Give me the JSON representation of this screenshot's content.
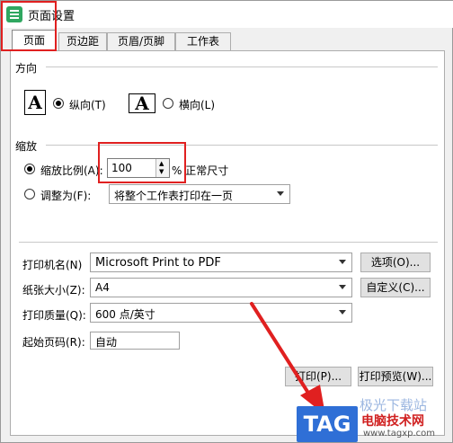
{
  "window": {
    "title": "页面设置"
  },
  "tabs": [
    {
      "label": "页面"
    },
    {
      "label": "页边距"
    },
    {
      "label": "页眉/页脚"
    },
    {
      "label": "工作表"
    }
  ],
  "orientation": {
    "section": "方向",
    "icon_glyph": "A",
    "portrait_label": "纵向(T)",
    "landscape_label": "横向(L)",
    "selected": "portrait"
  },
  "scaling": {
    "section": "缩放",
    "scale_label": "缩放比例(A):",
    "scale_value": "100",
    "scale_suffix": "% 正常尺寸",
    "fit_label": "调整为(F):",
    "fit_option": "将整个工作表打印在一页",
    "selected": "scale"
  },
  "printer": {
    "name_label": "打印机名(N)",
    "name_value": "Microsoft Print to PDF",
    "options_button": "选项(O)...",
    "paper_label": "纸张大小(Z):",
    "paper_value": "A4",
    "custom_button": "自定义(C)...",
    "quality_label": "打印质量(Q):",
    "quality_value": "600 点/英寸",
    "start_page_label": "起始页码(R):",
    "start_page_value": "自动"
  },
  "actions": {
    "print_button": "打印(P)...",
    "preview_button": "打印预览(W)..."
  },
  "watermark": {
    "tag": "TAG",
    "site_name": "电脑技术网",
    "url": "www.tagxp.com",
    "faint_text": "极光下载站"
  },
  "colors": {
    "highlight": "#e02020",
    "tag_bg": "#2f6fd6",
    "app_icon": "#2fa760"
  }
}
